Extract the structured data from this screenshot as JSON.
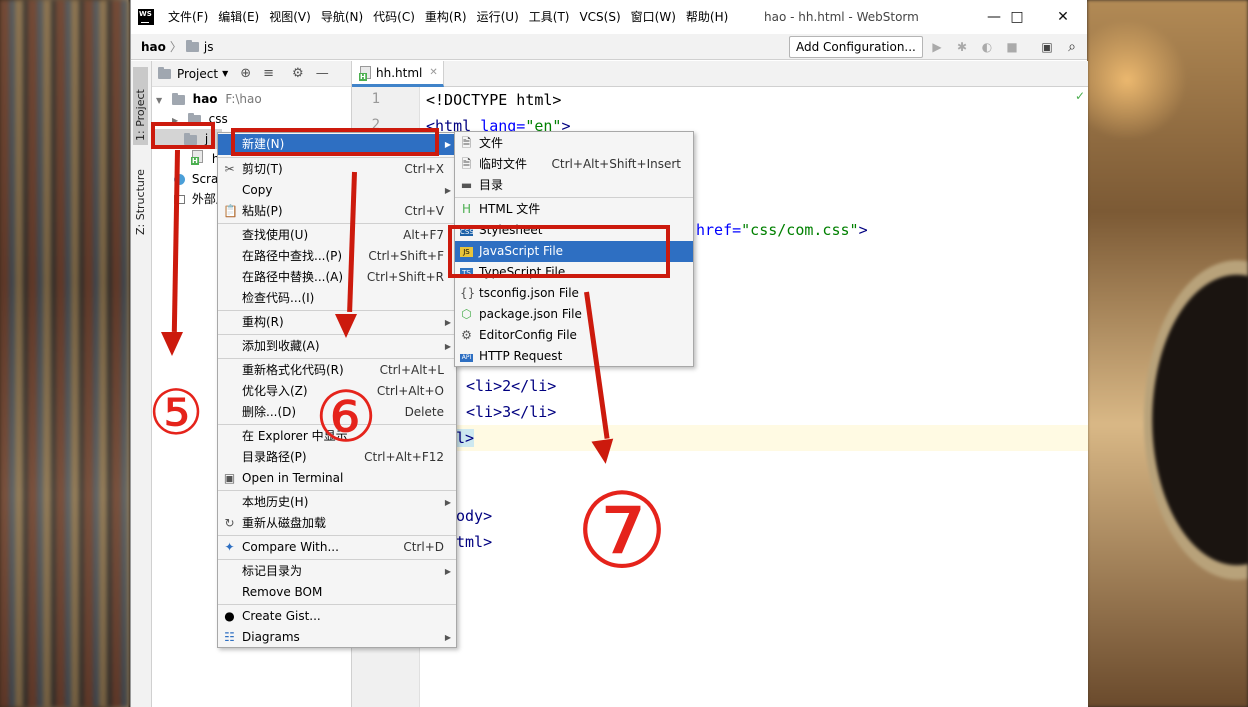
{
  "window": {
    "app_icon": "WS",
    "title": "hao - hh.html - WebStorm",
    "menu": [
      "文件(F)",
      "编辑(E)",
      "视图(V)",
      "导航(N)",
      "代码(C)",
      "重构(R)",
      "运行(U)",
      "工具(T)",
      "VCS(S)",
      "窗口(W)",
      "帮助(H)"
    ]
  },
  "navbar": {
    "crumb_root": "hao",
    "crumb_folder": "js",
    "add_config": "Add Configuration..."
  },
  "side_tabs": {
    "project": "1: Project",
    "structure": "Z: Structure"
  },
  "project_panel": {
    "header": "Project",
    "root_name": "hao",
    "root_path": "F:\\hao",
    "items": [
      "css",
      "js",
      "hh.html",
      "Scratches and Consoles",
      "外部库"
    ],
    "visible_items": [
      "css",
      "j",
      "hl",
      "Scrat",
      "外部厍"
    ]
  },
  "editor": {
    "tab": "hh.html",
    "line_numbers": [
      "1",
      "2"
    ],
    "code": {
      "l1": "<!DOCTYPE html>",
      "l2_tag": "<html ",
      "l2_attr": "lang=",
      "l2_val": "\"en\"",
      "l2_end": ">",
      "link_attr": "href=",
      "link_val": "\"css/com.css\"",
      "link_end": ">",
      "li2": "<li>2</li>",
      "li3": "<li>3</li>",
      "ul_close": "l>",
      "body_close": "ody>",
      "html_close": "tml>"
    }
  },
  "context_menu": {
    "items": [
      {
        "label": "新建(N)",
        "shortcut": "",
        "submenu": true
      },
      {
        "label": "剪切(T)",
        "shortcut": "Ctrl+X"
      },
      {
        "label": "Copy",
        "shortcut": "",
        "submenu": true
      },
      {
        "label": "粘贴(P)",
        "shortcut": "Ctrl+V"
      },
      {
        "label": "查找使用(U)",
        "shortcut": "Alt+F7"
      },
      {
        "label": "在路径中查找...(P)",
        "shortcut": "Ctrl+Shift+F"
      },
      {
        "label": "在路径中替换...(A)",
        "shortcut": "Ctrl+Shift+R"
      },
      {
        "label": "检查代码...(I)",
        "shortcut": ""
      },
      {
        "label": "重构(R)",
        "shortcut": "",
        "submenu": true
      },
      {
        "label": "添加到收藏(A)",
        "shortcut": "",
        "submenu": true
      },
      {
        "label": "重新格式化代码(R)",
        "shortcut": "Ctrl+Alt+L"
      },
      {
        "label": "优化导入(Z)",
        "shortcut": "Ctrl+Alt+O"
      },
      {
        "label": "删除...(D)",
        "shortcut": "Delete"
      },
      {
        "label": "在 Explorer 中显示",
        "shortcut": ""
      },
      {
        "label": "目录路径(P)",
        "shortcut": "Ctrl+Alt+F12"
      },
      {
        "label": "Open in Terminal",
        "shortcut": ""
      },
      {
        "label": "本地历史(H)",
        "shortcut": "",
        "submenu": true
      },
      {
        "label": "重新从磁盘加载",
        "shortcut": ""
      },
      {
        "label": "Compare With...",
        "shortcut": "Ctrl+D"
      },
      {
        "label": "标记目录为",
        "shortcut": "",
        "submenu": true
      },
      {
        "label": "Remove BOM",
        "shortcut": ""
      },
      {
        "label": "Create Gist...",
        "shortcut": ""
      },
      {
        "label": "Diagrams",
        "shortcut": "",
        "submenu": true
      }
    ]
  },
  "new_submenu": {
    "items": [
      {
        "label": "文件",
        "shortcut": ""
      },
      {
        "label": "临时文件",
        "shortcut": "Ctrl+Alt+Shift+Insert"
      },
      {
        "label": "目录",
        "shortcut": ""
      },
      {
        "label": "HTML 文件",
        "shortcut": ""
      },
      {
        "label": "Stylesheet",
        "shortcut": ""
      },
      {
        "label": "JavaScript File",
        "shortcut": ""
      },
      {
        "label": "TypeScript File",
        "shortcut": ""
      },
      {
        "label": "tsconfig.json File",
        "shortcut": ""
      },
      {
        "label": "package.json File",
        "shortcut": ""
      },
      {
        "label": "EditorConfig File",
        "shortcut": ""
      },
      {
        "label": "HTTP Request",
        "shortcut": ""
      }
    ]
  },
  "annotations": {
    "step5": "⑤",
    "step6": "⑥",
    "step7": "⑦",
    "color": "#cc1a0d"
  }
}
